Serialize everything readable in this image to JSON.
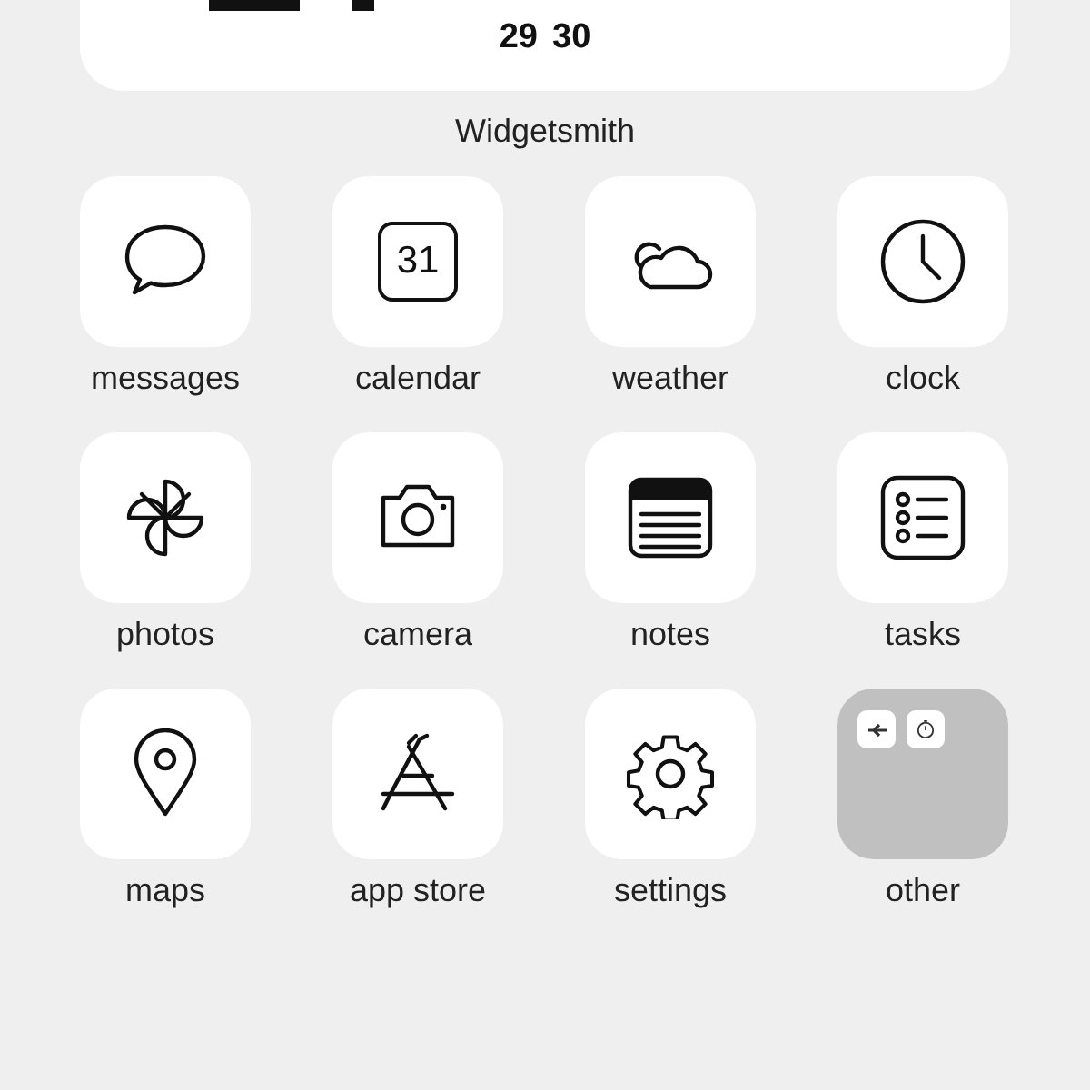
{
  "widget": {
    "dates": [
      "29",
      "30"
    ],
    "name": "Widgetsmith"
  },
  "apps": [
    {
      "label": "messages",
      "kind": "messages"
    },
    {
      "label": "calendar",
      "kind": "calendar",
      "icon_text": "31"
    },
    {
      "label": "weather",
      "kind": "weather"
    },
    {
      "label": "clock",
      "kind": "clock"
    },
    {
      "label": "photos",
      "kind": "photos"
    },
    {
      "label": "camera",
      "kind": "camera"
    },
    {
      "label": "notes",
      "kind": "notes"
    },
    {
      "label": "tasks",
      "kind": "tasks"
    },
    {
      "label": "maps",
      "kind": "maps"
    },
    {
      "label": "app store",
      "kind": "appstore"
    },
    {
      "label": "settings",
      "kind": "settings"
    },
    {
      "label": "other",
      "kind": "folder"
    }
  ]
}
